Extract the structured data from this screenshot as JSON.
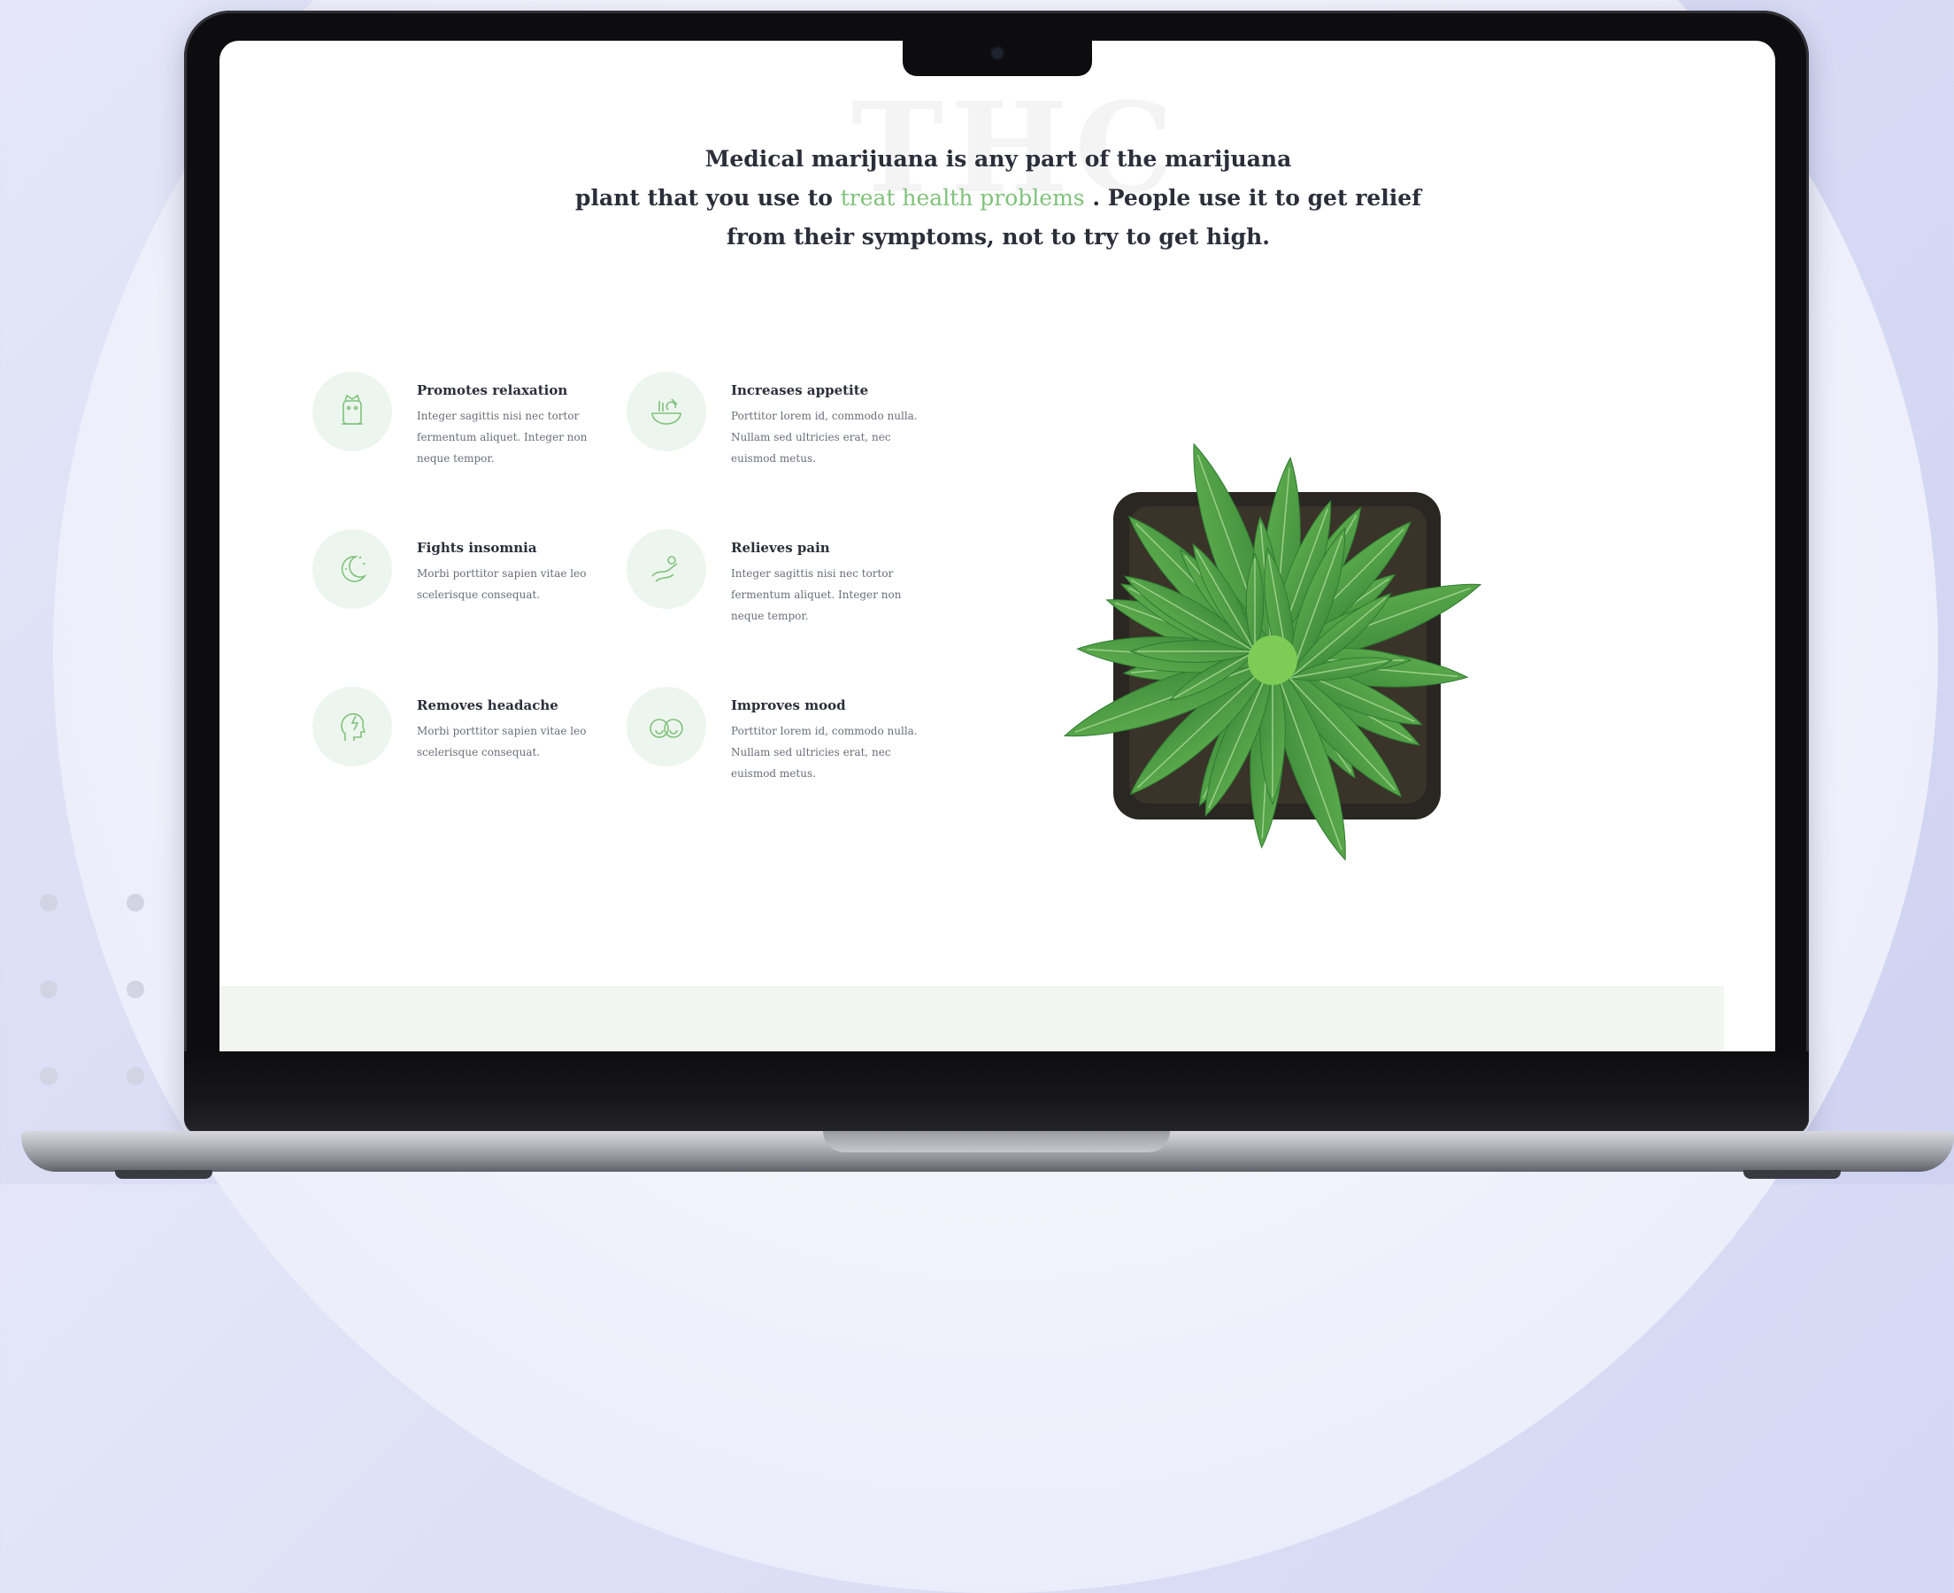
{
  "intro": {
    "line1": "Medical marijuana is any part of the marijuana",
    "line2_before": "plant that you use to",
    "line2_highlight": "treat health problems",
    "line2_after": ". People use it to get relief",
    "line3": "from their symptoms, not to try to get high."
  },
  "watermark": "THC",
  "features": [
    {
      "title": "Promotes relaxation",
      "text": "Integer sagittis nisi nec tortor fermentum aliquet. Integer non neque tempor.",
      "icon": "relaxation-icon"
    },
    {
      "title": "Increases appetite",
      "text": "Porttitor lorem id, commodo nulla. Nullam sed ultricies erat, nec euismod metus.",
      "icon": "appetite-icon"
    },
    {
      "title": "Fights insomnia",
      "text": "Morbi porttitor sapien vitae leo scelerisque consequat.",
      "icon": "moon-icon"
    },
    {
      "title": "Relieves pain",
      "text": "Integer sagittis nisi nec tortor fermentum aliquet. Integer non neque tempor.",
      "icon": "pain-relief-icon"
    },
    {
      "title": "Removes headache",
      "text": "Morbi porttitor sapien vitae leo scelerisque consequat.",
      "icon": "headache-icon"
    },
    {
      "title": "Improves mood",
      "text": "Porttitor lorem id, commodo nulla. Nullam sed ultricies erat, nec euismod metus.",
      "icon": "mood-icon"
    }
  ],
  "colors": {
    "accent_green": "#7fc27a",
    "icon_bg": "#edf6ee",
    "text_dark": "#2b2f3a"
  },
  "image": {
    "name": "cannabis-plant-image"
  }
}
